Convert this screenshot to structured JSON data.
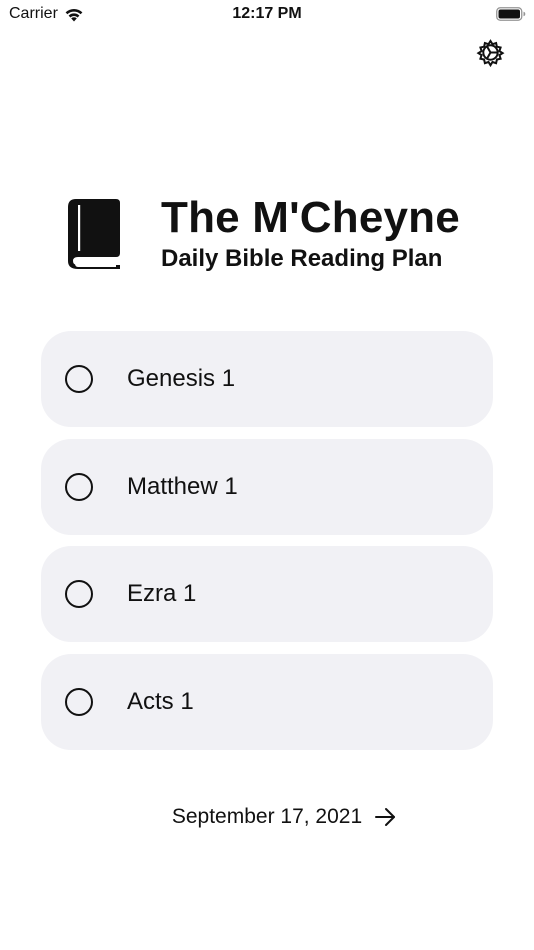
{
  "status_bar": {
    "carrier": "Carrier",
    "time": "12:17 PM",
    "wifi_icon": "wifi-icon",
    "battery_icon": "battery-icon"
  },
  "settings": {
    "icon": "gear-icon"
  },
  "header": {
    "icon": "book-icon",
    "title": "The M'Cheyne",
    "subtitle": "Daily Bible Reading Plan"
  },
  "readings": [
    {
      "label": "Genesis 1",
      "checked": false
    },
    {
      "label": "Matthew 1",
      "checked": false
    },
    {
      "label": "Ezra 1",
      "checked": false
    },
    {
      "label": "Acts 1",
      "checked": false
    }
  ],
  "date_nav": {
    "label": "September 17, 2021",
    "icon": "arrow-right-icon"
  },
  "colors": {
    "card_background": "#f1f1f5",
    "text": "#111111",
    "background": "#ffffff"
  }
}
